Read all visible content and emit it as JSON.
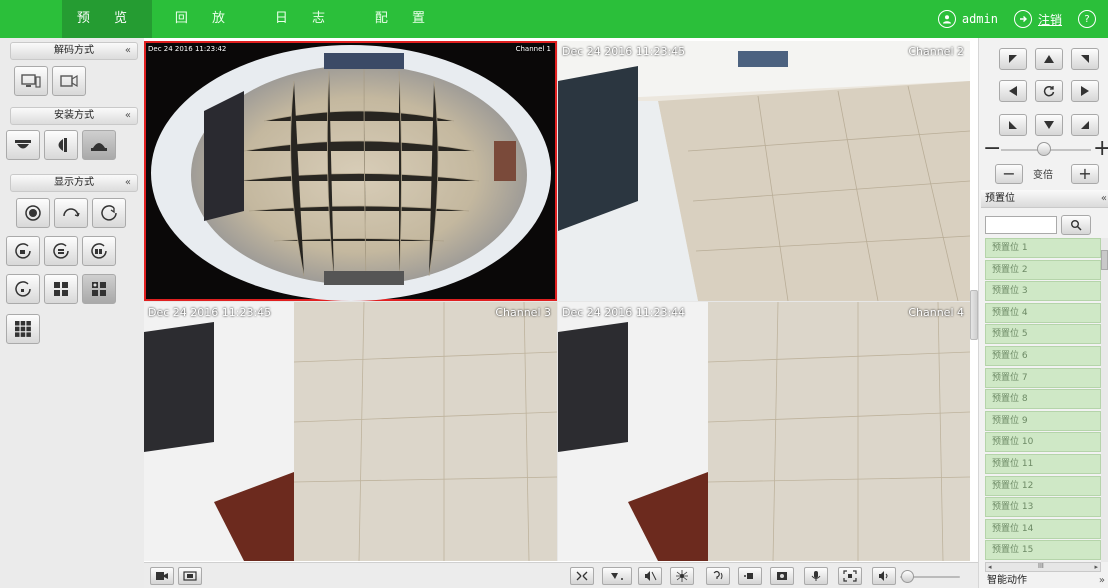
{
  "nav": {
    "tabs": [
      {
        "label": "预 览",
        "active": true
      },
      {
        "label": "回 放",
        "active": false
      },
      {
        "label": "日 志",
        "active": false
      },
      {
        "label": "配 置",
        "active": false
      }
    ],
    "user": "admin",
    "logout": "注销",
    "help_icon": "?"
  },
  "left_panel": {
    "decode_mode": {
      "title": "解码方式",
      "collapse": "«"
    },
    "install_mode": {
      "title": "安装方式",
      "collapse": "«"
    },
    "display_mode": {
      "title": "显示方式",
      "collapse": "«"
    }
  },
  "video": {
    "panes": [
      {
        "timestamp": "Dec 24 2016 11:23:42",
        "channel": "Channel 1",
        "selected": true
      },
      {
        "timestamp": "Dec 24 2016 11:23:45",
        "channel": "Channel 2",
        "selected": false
      },
      {
        "timestamp": "Dec 24 2016 11:23:45",
        "channel": "Channel 3",
        "selected": false
      },
      {
        "timestamp": "Dec 24 2016 11:23:44",
        "channel": "Channel 4",
        "selected": false
      }
    ]
  },
  "ptz": {
    "zoom_label": "变倍",
    "minus": "−",
    "plus": "+"
  },
  "presets": {
    "title": "预置位",
    "collapse": "«",
    "items": [
      "预置位 1",
      "预置位 2",
      "预置位 3",
      "预置位 4",
      "预置位 5",
      "预置位 6",
      "预置位 7",
      "预置位 8",
      "预置位 9",
      "预置位 10",
      "预置位 11",
      "预置位 12",
      "预置位 13",
      "预置位 14",
      "预置位 15"
    ],
    "hscroll_label": "III"
  },
  "smart_action": {
    "title": "智能动作",
    "collapse": "»"
  },
  "colors": {
    "accent": "#2bbf3a",
    "accent_dark": "#259c32",
    "selected_border": "#e02020",
    "preset_bg": "#cfe8c6"
  }
}
